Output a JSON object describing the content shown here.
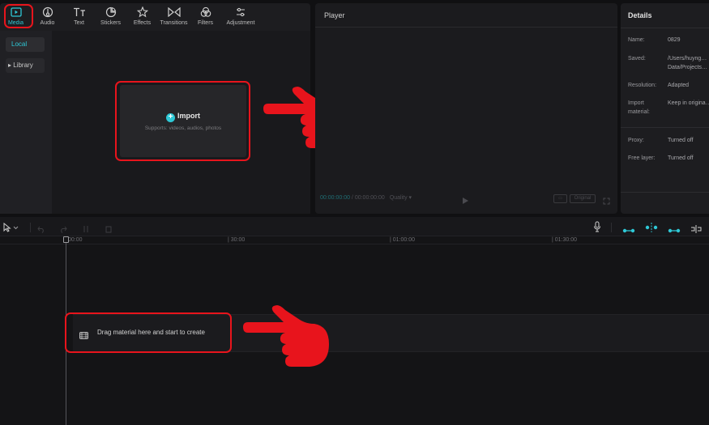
{
  "toolbar": {
    "tabs": [
      {
        "label": "Media",
        "icon": "media-icon",
        "active": true
      },
      {
        "label": "Audio",
        "icon": "audio-icon"
      },
      {
        "label": "Text",
        "icon": "text-icon"
      },
      {
        "label": "Stickers",
        "icon": "stickers-icon"
      },
      {
        "label": "Effects",
        "icon": "effects-icon"
      },
      {
        "label": "Transitions",
        "icon": "transitions-icon"
      },
      {
        "label": "Filters",
        "icon": "filters-icon"
      },
      {
        "label": "Adjustment",
        "icon": "adjustment-icon"
      }
    ]
  },
  "media": {
    "sidebar": {
      "local": "Local",
      "library": "▸ Library"
    },
    "import": {
      "title": "Import",
      "subtitle": "Supports: videos, audios, photos"
    }
  },
  "player": {
    "title": "Player",
    "time_current": "00:00:00:00",
    "time_total": " / 00:00:00:00",
    "quality": "Quality ▾",
    "original": "Original"
  },
  "details": {
    "title": "Details",
    "rows": [
      {
        "key": "Name:",
        "value": "0829"
      },
      {
        "key": "Saved:",
        "value": "/Users/huyng…",
        "value2": "Data/Projects…"
      },
      {
        "key": "Resolution:",
        "value": "Adapted"
      },
      {
        "key": "Import",
        "key2": "material:",
        "value": "Keep in origina…"
      },
      {
        "key": "Proxy:",
        "value": "Turned off"
      },
      {
        "key": "Free layer:",
        "value": "Turned off"
      }
    ]
  },
  "timeline": {
    "ticks": [
      "00:00",
      "| 30:00",
      "| 01:00:00",
      "| 01:30:00"
    ],
    "drag_hint": "Drag material here and start to create"
  },
  "colors": {
    "accent": "#2ec8d6",
    "highlight": "#e8141c",
    "background": "#101012"
  }
}
